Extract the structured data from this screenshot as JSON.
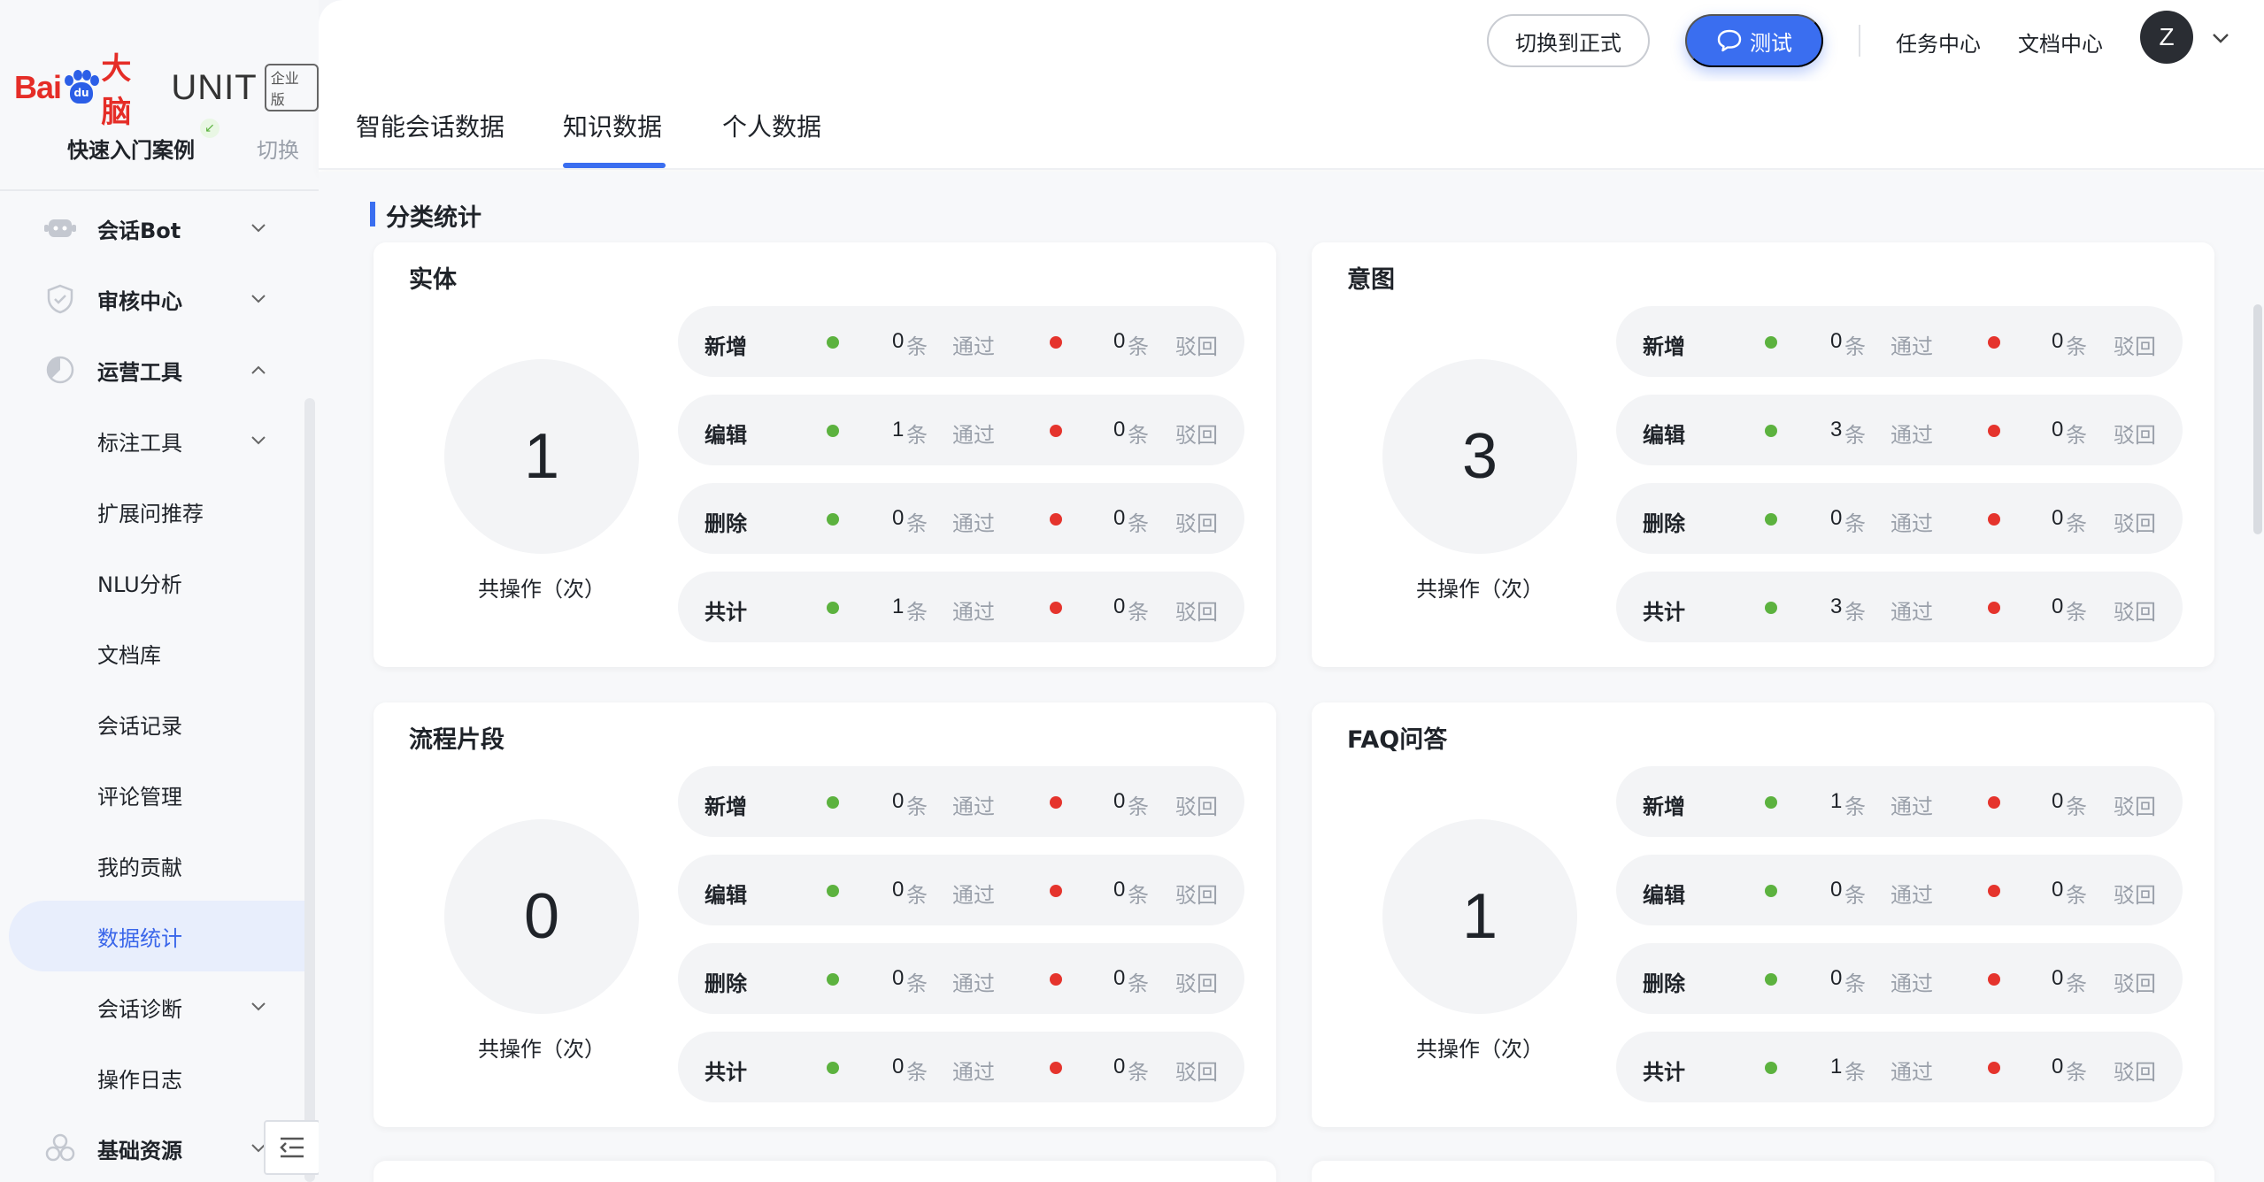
{
  "brand": {
    "bai": "Bai",
    "du": "du",
    "dn": "大脑",
    "unit": "UNIT",
    "edition": "企业版"
  },
  "sidebar": {
    "quick_case": "快速入门案例",
    "switch": "切换",
    "items": [
      {
        "label": "会话Bot",
        "type": "top",
        "chev": "down"
      },
      {
        "label": "审核中心",
        "type": "top",
        "chev": "down"
      },
      {
        "label": "运营工具",
        "type": "top",
        "chev": "up"
      },
      {
        "label": "标注工具",
        "type": "sub",
        "chev": "down"
      },
      {
        "label": "扩展问推荐",
        "type": "sub"
      },
      {
        "label": "NLU分析",
        "type": "sub"
      },
      {
        "label": "文档库",
        "type": "sub"
      },
      {
        "label": "会话记录",
        "type": "sub"
      },
      {
        "label": "评论管理",
        "type": "sub"
      },
      {
        "label": "我的贡献",
        "type": "sub"
      },
      {
        "label": "数据统计",
        "type": "sub",
        "active": true
      },
      {
        "label": "会话诊断",
        "type": "sub",
        "chev": "down"
      },
      {
        "label": "操作日志",
        "type": "sub"
      },
      {
        "label": "基础资源",
        "type": "top",
        "chev": "down"
      }
    ]
  },
  "topbar": {
    "switch_formal": "切换到正式",
    "test": "测试",
    "task_center": "任务中心",
    "doc_center": "文档中心",
    "avatar": "Z"
  },
  "tabs": [
    {
      "label": "智能会话数据",
      "active": false
    },
    {
      "label": "知识数据",
      "active": true
    },
    {
      "label": "个人数据",
      "active": false
    }
  ],
  "section_title": "分类统计",
  "labels": {
    "ops": "共操作（次）",
    "unit": "条",
    "pass": "通过",
    "reject": "驳回"
  },
  "cards": [
    {
      "title": "实体",
      "total": "1",
      "rows": [
        {
          "label": "新增",
          "pass": "0",
          "reject": "0"
        },
        {
          "label": "编辑",
          "pass": "1",
          "reject": "0"
        },
        {
          "label": "删除",
          "pass": "0",
          "reject": "0"
        },
        {
          "label": "共计",
          "pass": "1",
          "reject": "0"
        }
      ]
    },
    {
      "title": "意图",
      "total": "3",
      "rows": [
        {
          "label": "新增",
          "pass": "0",
          "reject": "0"
        },
        {
          "label": "编辑",
          "pass": "3",
          "reject": "0"
        },
        {
          "label": "删除",
          "pass": "0",
          "reject": "0"
        },
        {
          "label": "共计",
          "pass": "3",
          "reject": "0"
        }
      ]
    },
    {
      "title": "流程片段",
      "total": "0",
      "rows": [
        {
          "label": "新增",
          "pass": "0",
          "reject": "0"
        },
        {
          "label": "编辑",
          "pass": "0",
          "reject": "0"
        },
        {
          "label": "删除",
          "pass": "0",
          "reject": "0"
        },
        {
          "label": "共计",
          "pass": "0",
          "reject": "0"
        }
      ]
    },
    {
      "title": "FAQ问答",
      "total": "1",
      "rows": [
        {
          "label": "新增",
          "pass": "1",
          "reject": "0"
        },
        {
          "label": "编辑",
          "pass": "0",
          "reject": "0"
        },
        {
          "label": "删除",
          "pass": "0",
          "reject": "0"
        },
        {
          "label": "共计",
          "pass": "1",
          "reject": "0"
        }
      ]
    }
  ],
  "colors": {
    "accent": "#3a6ef0",
    "pass": "#5cb23f",
    "reject": "#e5342d"
  }
}
